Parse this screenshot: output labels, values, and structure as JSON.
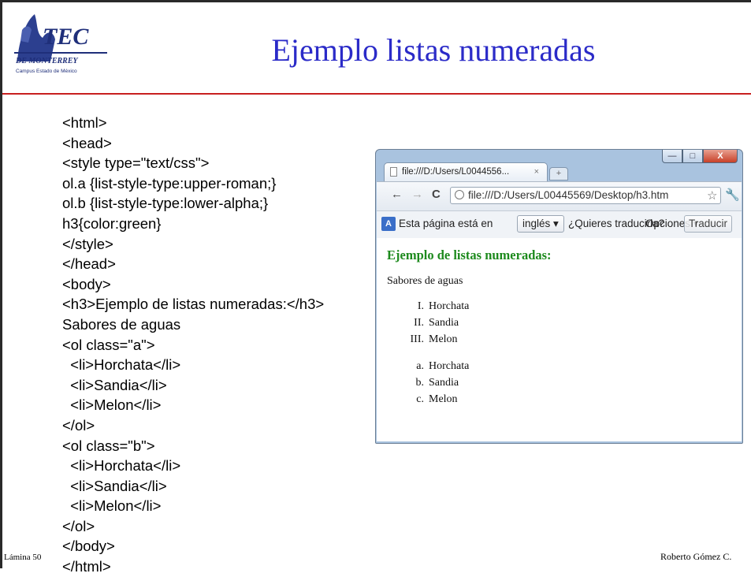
{
  "slide": {
    "title": "Ejemplo listas numeradas",
    "logo_text": "TEC",
    "logo_subtext": "DE MONTERREY",
    "logo_campus": "Campus Estado de México",
    "code_lines": [
      "<html>",
      "<head>",
      "<style type=\"text/css\">",
      "ol.a {list-style-type:upper-roman;}",
      "ol.b {list-style-type:lower-alpha;}",
      "h3{color:green}",
      "</style>",
      "</head>",
      "<body>",
      "<h3>Ejemplo de listas numeradas:</h3>",
      "Sabores de aguas",
      "<ol class=\"a\">",
      "  <li>Horchata</li>",
      "  <li>Sandia</li>",
      "  <li>Melon</li>",
      "</ol>",
      "<ol class=\"b\">",
      "  <li>Horchata</li>",
      "  <li>Sandia</li>",
      "  <li>Melon</li>",
      "</ol>",
      "</body>",
      "</html>"
    ],
    "footer_left": "Lámina 50",
    "footer_right": "Roberto Gómez C."
  },
  "browser": {
    "tab_title": "file:///D:/Users/L0044556...",
    "tab_close": "×",
    "new_tab": "+",
    "address": "file:///D:/Users/L00445569/Desktop/h3.htm",
    "back": "←",
    "forward": "→",
    "reload": "C",
    "star": "☆",
    "wrench": "🔧",
    "win_min": "—",
    "win_max": "□",
    "win_close": "X",
    "translate_icon": "A",
    "infobar_text": "Esta página está en",
    "language": "inglés ▾",
    "question": "¿Quieres traducirla?",
    "options": "Opciones ▾",
    "translate_button": "Traducir",
    "page": {
      "heading": "Ejemplo de listas numeradas:",
      "paragraph": "Sabores de aguas",
      "list_a": [
        {
          "marker": "I.",
          "text": "Horchata"
        },
        {
          "marker": "II.",
          "text": "Sandia"
        },
        {
          "marker": "III.",
          "text": "Melon"
        }
      ],
      "list_b": [
        {
          "marker": "a.",
          "text": "Horchata"
        },
        {
          "marker": "b.",
          "text": "Sandia"
        },
        {
          "marker": "c.",
          "text": "Melon"
        }
      ]
    }
  },
  "colors": {
    "title": "#2b2bc8",
    "rule": "#c82020",
    "heading_green": "#1d8a1d"
  }
}
